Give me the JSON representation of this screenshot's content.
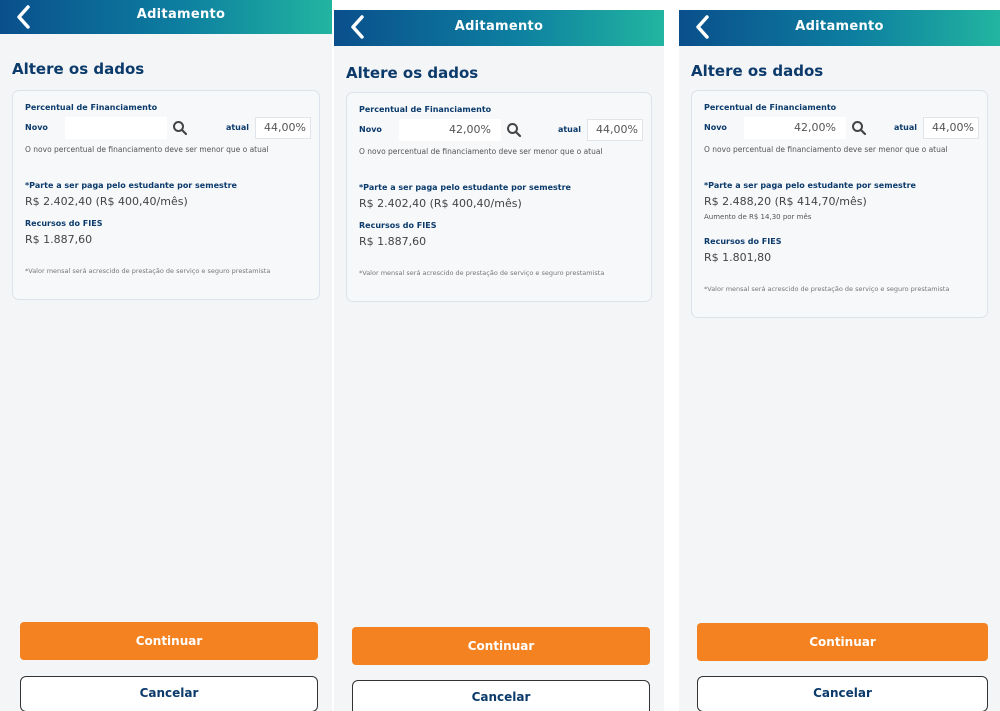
{
  "screens": [
    {
      "header_title": "Aditamento",
      "heading": "Altere os dados",
      "section_label": "Percentual de Financiamento",
      "novo_label": "Novo",
      "novo_value": "",
      "atual_label": "atual",
      "atual_value": "44,00%",
      "info_note": "O novo percentual de financiamento deve ser menor que o atual",
      "parte_label": "*Parte a ser paga pelo estudante por semestre",
      "parte_value": "R$ 2.402,40 (R$ 400,40/mês)",
      "aumento_text": "",
      "recursos_label": "Recursos do FIES",
      "recursos_value": "R$ 1.887,60",
      "footnote": "*Valor mensal será acrescido de prestação de serviço e seguro prestamista",
      "continue_label": "Continuar",
      "cancel_label": "Cancelar"
    },
    {
      "header_title": "Aditamento",
      "heading": "Altere os dados",
      "section_label": "Percentual de Financiamento",
      "novo_label": "Novo",
      "novo_value": "42,00%",
      "atual_label": "atual",
      "atual_value": "44,00%",
      "info_note": "O novo percentual de financiamento deve ser menor que o atual",
      "parte_label": "*Parte a ser paga pelo estudante por semestre",
      "parte_value": "R$ 2.402,40 (R$ 400,40/mês)",
      "aumento_text": "",
      "recursos_label": "Recursos do FIES",
      "recursos_value": "R$ 1.887,60",
      "footnote": "*Valor mensal será acrescido de prestação de serviço e seguro prestamista",
      "continue_label": "Continuar",
      "cancel_label": "Cancelar"
    },
    {
      "header_title": "Aditamento",
      "heading": "Altere os dados",
      "section_label": "Percentual de Financiamento",
      "novo_label": "Novo",
      "novo_value": "42,00%",
      "atual_label": "atual",
      "atual_value": "44,00%",
      "info_note": "O novo percentual de financiamento deve ser menor que o atual",
      "parte_label": "*Parte a ser paga pelo estudante por semestre",
      "parte_value": "R$ 2.488,20 (R$ 414,70/mês)",
      "aumento_text": "Aumento de R$ 14,30 por mês",
      "recursos_label": "Recursos do FIES",
      "recursos_value": "R$ 1.801,80",
      "footnote": "*Valor mensal será acrescido de prestação de serviço e seguro prestamista",
      "continue_label": "Continuar",
      "cancel_label": "Cancelar"
    }
  ],
  "icons": {
    "back": "chevron-left-icon",
    "search": "search-icon"
  },
  "colors": {
    "header_start": "#0a4f8c",
    "header_end": "#22b5a0",
    "primary_button": "#f58220",
    "heading": "#0b3a6b"
  }
}
